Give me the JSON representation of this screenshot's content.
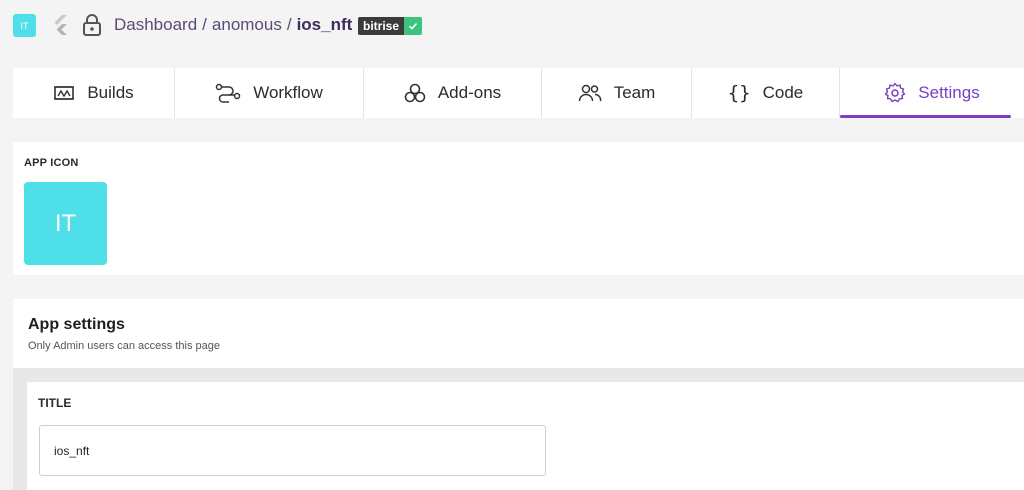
{
  "header": {
    "app_badge": "IT",
    "breadcrumb": {
      "dashboard": "Dashboard",
      "separator": "/",
      "owner": "anomous",
      "app": "ios_nft"
    },
    "status_badge": {
      "name": "bitrise",
      "icon": "check-icon",
      "color": "#3ac47d"
    },
    "icons": [
      "flutter-icon",
      "lock-icon"
    ]
  },
  "tabs": [
    {
      "label": "Builds",
      "icon": "builds-icon",
      "active": false
    },
    {
      "label": "Workflow",
      "icon": "workflow-icon",
      "active": false
    },
    {
      "label": "Add-ons",
      "icon": "addons-icon",
      "active": false
    },
    {
      "label": "Team",
      "icon": "team-icon",
      "active": false
    },
    {
      "label": "Code",
      "icon": "code-icon",
      "active": false
    },
    {
      "label": "Settings",
      "icon": "gear-icon",
      "active": true
    }
  ],
  "app_icon_section": {
    "label": "APP ICON",
    "icon_text": "IT",
    "icon_color": "#4fdfe9"
  },
  "app_settings": {
    "title": "App settings",
    "subtitle": "Only Admin users can access this page",
    "title_field": {
      "label": "TITLE",
      "value": "ios_nft"
    }
  },
  "colors": {
    "accent": "#7a3ec7",
    "breadcrumb": "#5b4a78"
  }
}
